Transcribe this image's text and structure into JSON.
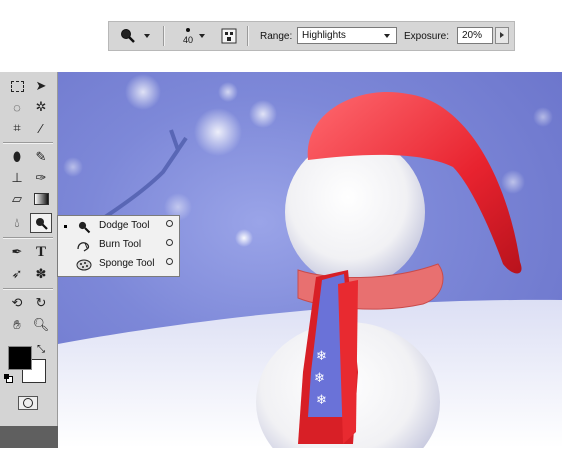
{
  "options_bar": {
    "tool_icon": "dodge-icon",
    "brush_size": "40",
    "range_label": "Range:",
    "range_value": "Highlights",
    "exposure_label": "Exposure:",
    "exposure_value": "20%"
  },
  "toolbox": {
    "tools": [
      "rectangular-marquee",
      "move",
      "lasso",
      "magic-wand",
      "crop",
      "eyedropper",
      "healing-brush",
      "brush",
      "clone-stamp",
      "history-brush",
      "eraser",
      "gradient",
      "blur",
      "dodge",
      "pen",
      "type",
      "path-selection",
      "custom-shape",
      "3d-rotate",
      "3d-orbit",
      "hand",
      "zoom"
    ],
    "foreground_color": "#000000",
    "background_color": "#ffffff"
  },
  "flyout": {
    "items": [
      {
        "label": "Dodge Tool",
        "key": "O",
        "icon": "dodge-icon",
        "active": true
      },
      {
        "label": "Burn Tool",
        "key": "O",
        "icon": "burn-icon",
        "active": false
      },
      {
        "label": "Sponge Tool",
        "key": "O",
        "icon": "sponge-icon",
        "active": false
      }
    ]
  },
  "colors": {
    "sky": "#7d88d8",
    "hat": "#e8232f",
    "scarf": "#e87070",
    "scarf_band": "#6a72d8"
  }
}
